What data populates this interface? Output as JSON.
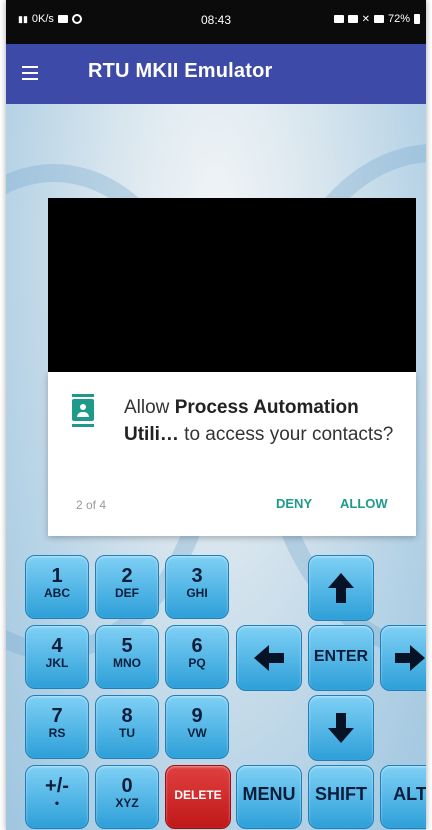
{
  "status_bar": {
    "left_text": "0K/s",
    "time": "08:43",
    "battery": "72%"
  },
  "app_bar": {
    "title": "RTU MKII Emulator",
    "menu_icon": "hamburger-menu-icon"
  },
  "dialog": {
    "icon": "contacts-icon",
    "message_prefix": "Allow ",
    "app_name": "Process Automation Utili…",
    "message_suffix": " to access your contacts?",
    "counter": "2 of 4",
    "deny_label": "DENY",
    "allow_label": "ALLOW"
  },
  "keypad": {
    "k1": {
      "num": "1",
      "letters": "ABC"
    },
    "k2": {
      "num": "2",
      "letters": "DEF"
    },
    "k3": {
      "num": "3",
      "letters": "GHI"
    },
    "k4": {
      "num": "4",
      "letters": "JKL"
    },
    "k5": {
      "num": "5",
      "letters": "MNO"
    },
    "k6": {
      "num": "6",
      "letters": "PQ"
    },
    "k7": {
      "num": "7",
      "letters": "RS"
    },
    "k8": {
      "num": "8",
      "letters": "TU"
    },
    "k9": {
      "num": "9",
      "letters": "VW"
    },
    "kplus": {
      "num": "+/-",
      "letters": "•"
    },
    "k0": {
      "num": "0",
      "letters": "XYZ"
    },
    "delete": "DELETE",
    "enter": "ENTER",
    "menu": "MENU",
    "shift": "SHIFT",
    "alt": "ALT"
  },
  "colors": {
    "app_bar": "#3e4aa8",
    "accent": "#1f9a8a",
    "key_blue": "#2d9fd8",
    "delete_red": "#d02828"
  }
}
